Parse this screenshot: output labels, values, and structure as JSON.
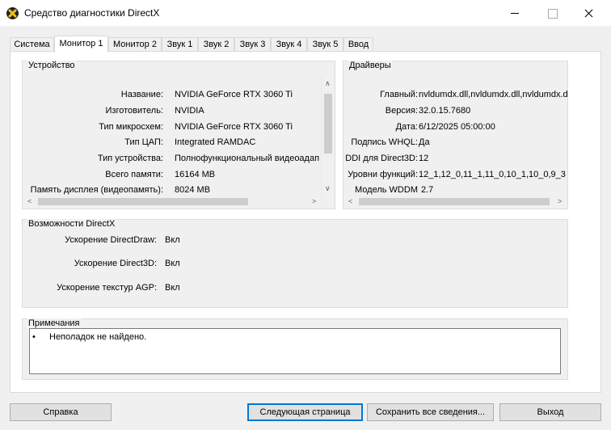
{
  "window": {
    "title": "Средство диагностики DirectX",
    "minimize_icon": "minimize-icon",
    "maximize_icon": "maximize-icon",
    "close_icon": "close-icon"
  },
  "tabs": [
    {
      "label": "Система"
    },
    {
      "label": "Монитор 1",
      "active": true
    },
    {
      "label": "Монитор 2"
    },
    {
      "label": "Звук 1"
    },
    {
      "label": "Звук 2"
    },
    {
      "label": "Звук 3"
    },
    {
      "label": "Звук 4"
    },
    {
      "label": "Звук 5"
    },
    {
      "label": "Ввод"
    }
  ],
  "device": {
    "title": "Устройство",
    "rows": [
      {
        "label": "Название:",
        "value": "NVIDIA GeForce RTX 3060 Ti"
      },
      {
        "label": "Изготовитель:",
        "value": "NVIDIA"
      },
      {
        "label": "Тип микросхем:",
        "value": "NVIDIA GeForce RTX 3060 Ti"
      },
      {
        "label": "Тип ЦАП:",
        "value": "Integrated RAMDAC"
      },
      {
        "label": "Тип устройства:",
        "value": "Полнофункциональный видеоадап"
      },
      {
        "label": "Всего памяти:",
        "value": "16164 MB"
      },
      {
        "label": "Память дисплея (видеопамять):",
        "value": "8024 MB"
      }
    ]
  },
  "drivers": {
    "title": "Драйверы",
    "rows": [
      {
        "label": "Главный:",
        "value": "nvldumdx.dll,nvldumdx.dll,nvldumdx.d"
      },
      {
        "label": "Версия:",
        "value": "32.0.15.7680"
      },
      {
        "label": "Дата:",
        "value": "6/12/2025 05:00:00"
      },
      {
        "label": "Подпись WHQL:",
        "value": "Да"
      },
      {
        "label": "DDI для Direct3D:",
        "value": "12"
      },
      {
        "label": "Уровни функций:",
        "value": "12_1,12_0,11_1,11_0,10_1,10_0,9_3"
      },
      {
        "label": "Модель WDDM",
        "value": "2.7"
      }
    ]
  },
  "directx": {
    "title": "Возможности DirectX",
    "rows": [
      {
        "label": "Ускорение DirectDraw:",
        "value": "Вкл"
      },
      {
        "label": "Ускорение Direct3D:",
        "value": "Вкл"
      },
      {
        "label": "Ускорение текстур AGP:",
        "value": "Вкл"
      }
    ]
  },
  "notes": {
    "title": "Примечания",
    "items": [
      "Неполадок не найдено."
    ]
  },
  "buttons": {
    "help": "Справка",
    "next": "Следующая страница",
    "save": "Сохранить все сведения...",
    "exit": "Выход"
  }
}
